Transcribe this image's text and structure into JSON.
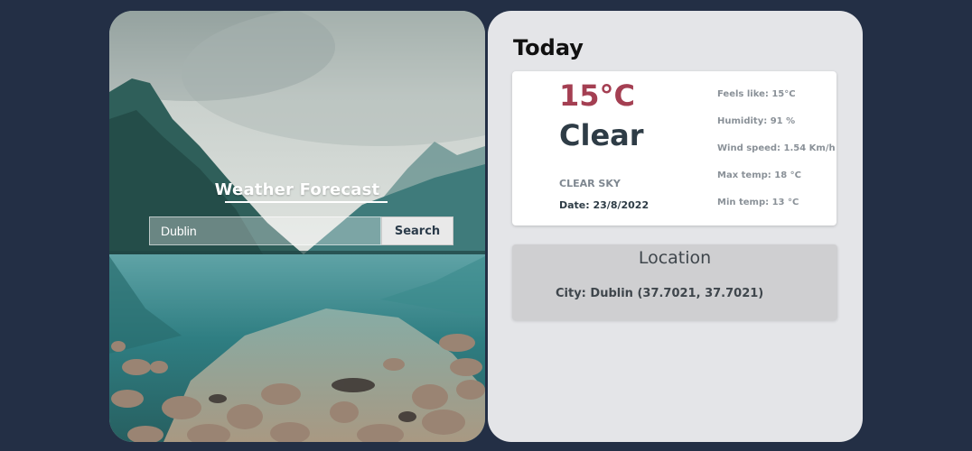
{
  "app": {
    "title": "Weather Forecast"
  },
  "search": {
    "value": "Dublin",
    "button_label": "Search"
  },
  "today": {
    "heading": "Today",
    "temperature": "15°C",
    "condition": "Clear",
    "description": "CLEAR SKY",
    "date": "Date: 23/8/2022",
    "details": {
      "feels_like": "Feels like: 15°C",
      "humidity": "Humidity: 91 %",
      "wind_speed": "Wind speed: 1.54 Km/h",
      "max_temp": "Max temp: 18 °C",
      "min_temp": "Min temp: 13 °C"
    }
  },
  "location": {
    "heading": "Location",
    "city": "City: Dublin (37.7021, 37.7021)"
  },
  "colors": {
    "page_background": "#232f45",
    "panel_background": "#e4e5e8",
    "temperature_accent": "#a43f52",
    "condition_text": "#2e3c46"
  }
}
